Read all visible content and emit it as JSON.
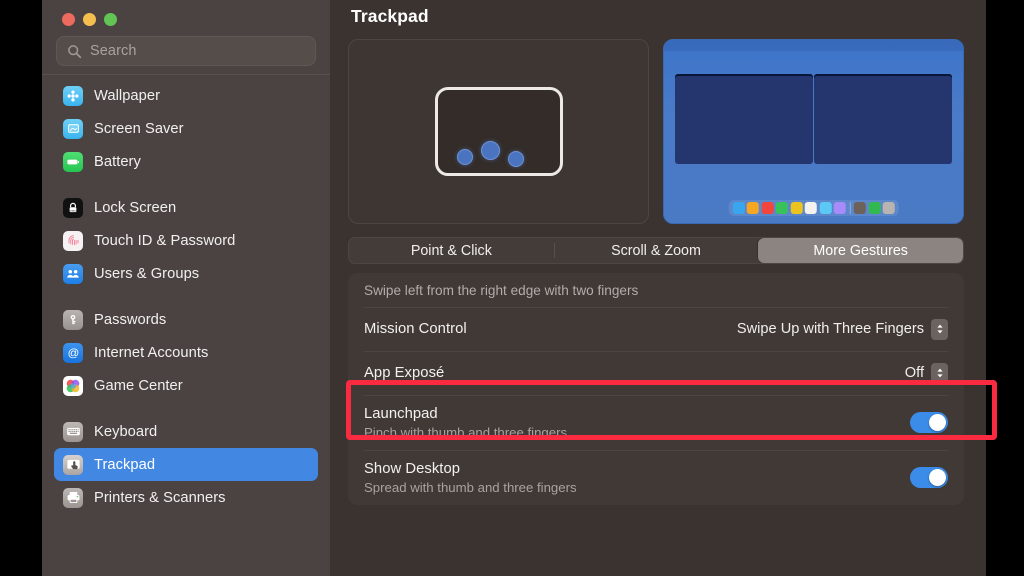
{
  "window": {
    "traffic_lights": [
      "close",
      "minimize",
      "zoom"
    ],
    "colors": {
      "accent_blue": "#4288e3",
      "toggle_on": "#3b8ce8",
      "highlight_red": "#fa2b41",
      "sidebar_bg": "#4a4341",
      "content_bg": "#3b3330"
    }
  },
  "sidebar": {
    "search": {
      "placeholder": "Search",
      "value": ""
    },
    "groups": [
      {
        "items": [
          {
            "label": "Wallpaper",
            "icon": "wallpaper-icon",
            "selected": false
          },
          {
            "label": "Screen Saver",
            "icon": "screen-saver-icon",
            "selected": false
          },
          {
            "label": "Battery",
            "icon": "battery-icon",
            "selected": false
          }
        ]
      },
      {
        "items": [
          {
            "label": "Lock Screen",
            "icon": "lock-screen-icon",
            "selected": false
          },
          {
            "label": "Touch ID & Password",
            "icon": "touch-id-icon",
            "selected": false
          },
          {
            "label": "Users & Groups",
            "icon": "users-groups-icon",
            "selected": false
          }
        ]
      },
      {
        "items": [
          {
            "label": "Passwords",
            "icon": "passwords-key-icon",
            "selected": false
          },
          {
            "label": "Internet Accounts",
            "icon": "internet-accounts-icon",
            "selected": false
          },
          {
            "label": "Game Center",
            "icon": "game-center-icon",
            "selected": false
          }
        ]
      },
      {
        "items": [
          {
            "label": "Keyboard",
            "icon": "keyboard-icon",
            "selected": false
          },
          {
            "label": "Trackpad",
            "icon": "trackpad-icon",
            "selected": true
          },
          {
            "label": "Printers & Scanners",
            "icon": "printer-icon",
            "selected": false
          }
        ]
      }
    ]
  },
  "main": {
    "title": "Trackpad",
    "preview": {
      "gesture_preview_name": "trackpad-three-finger-preview",
      "desktop_preview_name": "desktop-mission-control-preview",
      "dock_colors": [
        "#3aa6f0",
        "#f5a623",
        "#f2463c",
        "#38c25a",
        "#efc31e",
        "#f4f2ef",
        "#5bc8f5",
        "#a78bfa",
        "#6d615b",
        "#32b84f",
        "#b9b4b0"
      ]
    },
    "tabs": [
      {
        "label": "Point & Click",
        "active": false
      },
      {
        "label": "Scroll & Zoom",
        "active": false
      },
      {
        "label": "More Gestures",
        "active": true
      }
    ],
    "rows": [
      {
        "type": "caption",
        "caption": "Swipe left from the right edge with two fingers"
      },
      {
        "type": "popup",
        "title": "Mission Control",
        "value": "Swipe Up with Three Fingers"
      },
      {
        "type": "popup",
        "title": "App Exposé",
        "value": "Off",
        "highlighted": true
      },
      {
        "type": "toggle",
        "title": "Launchpad",
        "subtitle": "Pinch with thumb and three fingers",
        "enabled": true
      },
      {
        "type": "toggle",
        "title": "Show Desktop",
        "subtitle": "Spread with thumb and three fingers",
        "enabled": true
      }
    ]
  }
}
